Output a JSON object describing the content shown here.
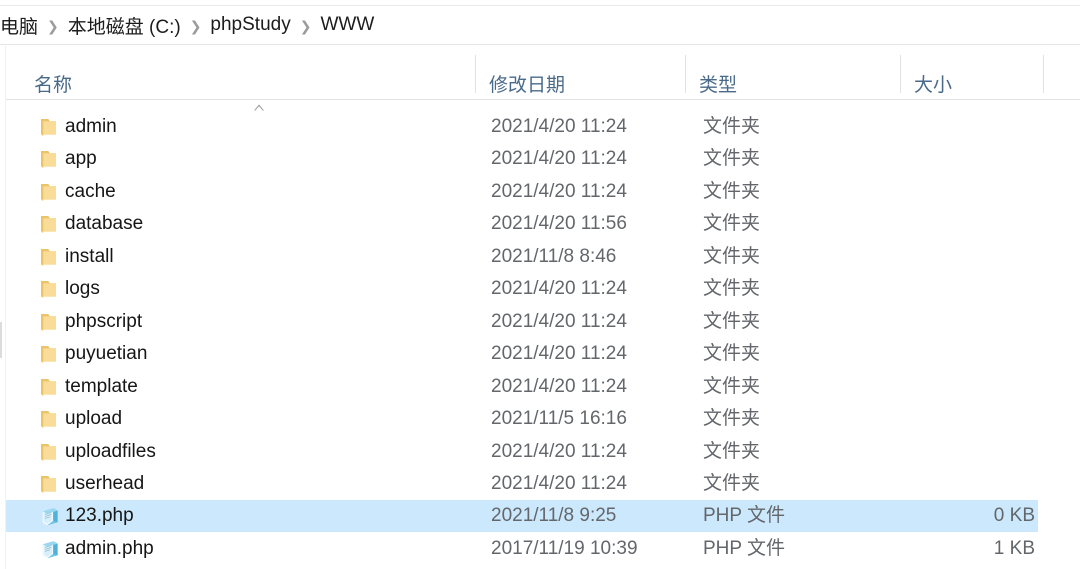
{
  "window": {
    "app": "File Explorer",
    "breadcrumb": {
      "separator": "❯",
      "items": [
        {
          "label": "电脑"
        },
        {
          "label": "本地磁盘 (C:)"
        },
        {
          "label": "phpStudy"
        },
        {
          "label": "WWW"
        }
      ]
    }
  },
  "columns": {
    "sort_indicator": "ascending-caret",
    "headers": [
      {
        "key": "name",
        "label": "名称"
      },
      {
        "key": "date",
        "label": "修改日期"
      },
      {
        "key": "type",
        "label": "类型"
      },
      {
        "key": "size",
        "label": "大小"
      }
    ]
  },
  "colors": {
    "selection": "#cce8fc",
    "header_text": "#4a6a8a",
    "row_text": "#161616",
    "secondary_text": "#63676b",
    "folder_icon": "#f6d487",
    "php_icon": "#8fd4ef"
  },
  "files": [
    {
      "name": "admin",
      "date": "2021/4/20 11:24",
      "type": "文件夹",
      "size": "",
      "icon": "folder-icon",
      "selected": false
    },
    {
      "name": "app",
      "date": "2021/4/20 11:24",
      "type": "文件夹",
      "size": "",
      "icon": "folder-icon",
      "selected": false
    },
    {
      "name": "cache",
      "date": "2021/4/20 11:24",
      "type": "文件夹",
      "size": "",
      "icon": "folder-icon",
      "selected": false
    },
    {
      "name": "database",
      "date": "2021/4/20 11:56",
      "type": "文件夹",
      "size": "",
      "icon": "folder-icon",
      "selected": false
    },
    {
      "name": "install",
      "date": "2021/11/8 8:46",
      "type": "文件夹",
      "size": "",
      "icon": "folder-icon",
      "selected": false
    },
    {
      "name": "logs",
      "date": "2021/4/20 11:24",
      "type": "文件夹",
      "size": "",
      "icon": "folder-icon",
      "selected": false
    },
    {
      "name": "phpscript",
      "date": "2021/4/20 11:24",
      "type": "文件夹",
      "size": "",
      "icon": "folder-icon",
      "selected": false
    },
    {
      "name": "puyuetian",
      "date": "2021/4/20 11:24",
      "type": "文件夹",
      "size": "",
      "icon": "folder-icon",
      "selected": false
    },
    {
      "name": "template",
      "date": "2021/4/20 11:24",
      "type": "文件夹",
      "size": "",
      "icon": "folder-icon",
      "selected": false
    },
    {
      "name": "upload",
      "date": "2021/11/5 16:16",
      "type": "文件夹",
      "size": "",
      "icon": "folder-icon",
      "selected": false
    },
    {
      "name": "uploadfiles",
      "date": "2021/4/20 11:24",
      "type": "文件夹",
      "size": "",
      "icon": "folder-icon",
      "selected": false
    },
    {
      "name": "userhead",
      "date": "2021/4/20 11:24",
      "type": "文件夹",
      "size": "",
      "icon": "folder-icon",
      "selected": false
    },
    {
      "name": "123.php",
      "date": "2021/11/8 9:25",
      "type": "PHP 文件",
      "size": "0 KB",
      "icon": "php-file-icon",
      "selected": true
    },
    {
      "name": "admin.php",
      "date": "2017/11/19 10:39",
      "type": "PHP 文件",
      "size": "1 KB",
      "icon": "php-file-icon",
      "selected": false
    }
  ]
}
